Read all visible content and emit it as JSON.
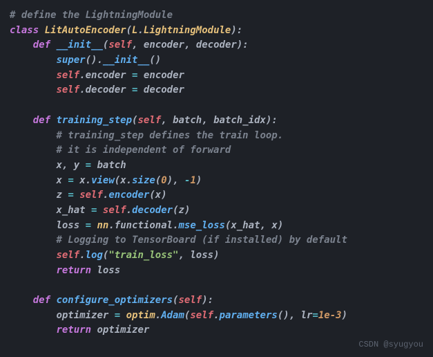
{
  "code": {
    "c1": "# define the LightningModule",
    "kw_class": "class",
    "cls_LitAutoEncoder": "LitAutoEncoder",
    "cls_L": "L",
    "cls_LightningModule": "LightningModule",
    "kw_def": "def",
    "fn_init": "__init__",
    "self": "self",
    "p_encoder": "encoder",
    "p_decoder": "decoder",
    "fn_super": "super",
    "fn_init_call": "__init__",
    "fn_training_step": "training_step",
    "p_batch": "batch",
    "p_batch_idx": "batch_idx",
    "c2": "# training_step defines the train loop.",
    "c3": "# it is independent of forward",
    "p_x": "x",
    "p_y": "y",
    "fn_view": "view",
    "fn_size": "size",
    "n_0": "0",
    "n_m1": "1",
    "p_z": "z",
    "p_x_hat": "x_hat",
    "p_loss": "loss",
    "cls_nn": "nn",
    "p_functional": "functional",
    "fn_mse_loss": "mse_loss",
    "c4": "# Logging to TensorBoard (if installed) by default",
    "fn_log": "log",
    "s_train_loss": "\"train_loss\"",
    "kw_return": "return",
    "fn_configure": "configure_optimizers",
    "p_optimizer": "optimizer",
    "cls_optim": "optim",
    "fn_Adam": "Adam",
    "fn_parameters": "parameters",
    "p_lr": "lr",
    "n_lr": "1e-3",
    "dot": ".",
    "com": ",",
    "col": ":",
    "lp": "(",
    "rp": ")",
    "eq": "=",
    "minus": "-"
  },
  "watermark": "CSDN @syugyou"
}
